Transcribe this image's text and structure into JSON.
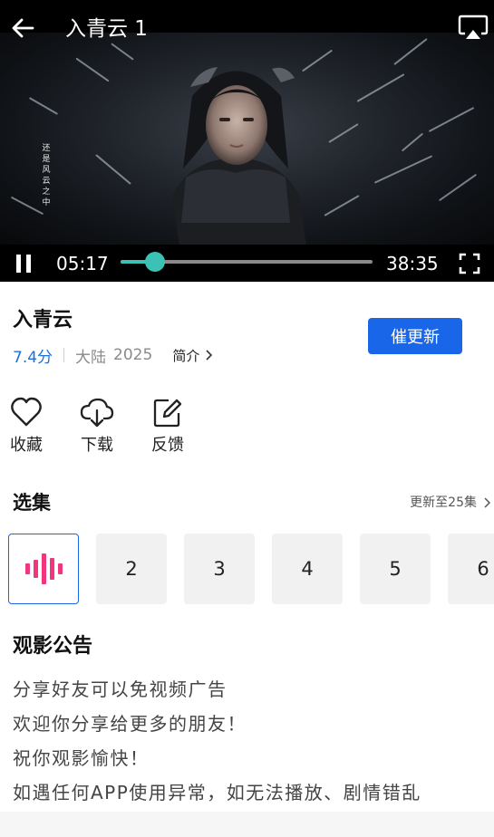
{
  "player": {
    "episode_title": "入青云 1",
    "current_time": "05:17",
    "total_time": "38:35",
    "progress": 0.137,
    "subtitle_vertical": [
      "还",
      "是",
      "风",
      "云",
      "之",
      "中"
    ],
    "icons": {
      "back": "arrow-left-icon",
      "cast": "airplay-icon",
      "pause": "pause-icon",
      "fullscreen": "fullscreen-icon"
    },
    "accent_color": "#3cc1b5"
  },
  "show": {
    "title": "入青云",
    "rating": "7.4分",
    "region": "大陆",
    "year": "2025",
    "intro_label": "简介",
    "urge_button": "催更新",
    "urge_color": "#1967e8",
    "rating_color": "#1f6fd8"
  },
  "actions": [
    {
      "label": "收藏",
      "icon": "heart-icon"
    },
    {
      "label": "下载",
      "icon": "cloud-download-icon"
    },
    {
      "label": "反馈",
      "icon": "edit-feedback-icon"
    }
  ],
  "episodes": {
    "section_title": "选集",
    "update_status": "更新至25集",
    "playing_icon": "playing-equalizer-icon",
    "items": [
      "1",
      "2",
      "3",
      "4",
      "5",
      "6"
    ],
    "current_index": 0
  },
  "notice": {
    "title": "观影公告",
    "lines": [
      "分享好友可以免视频广告",
      "欢迎你分享给更多的朋友！",
      "祝你观影愉快！",
      "如遇任何APP使用异常，如无法播放、剧情错乱"
    ]
  }
}
